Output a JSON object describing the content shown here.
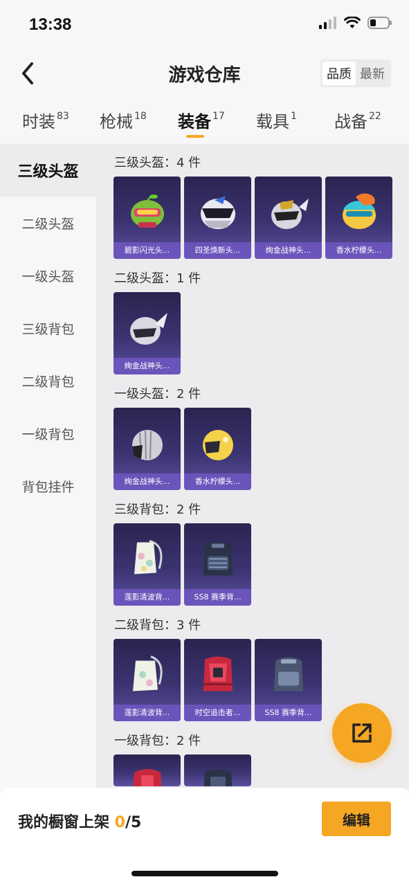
{
  "status": {
    "time": "13:38"
  },
  "nav": {
    "title": "游戏仓库",
    "sort": [
      "品质",
      "最新"
    ]
  },
  "tabs": [
    {
      "label": "时装",
      "count": "83"
    },
    {
      "label": "枪械",
      "count": "18"
    },
    {
      "label": "装备",
      "count": "17"
    },
    {
      "label": "载具",
      "count": "1"
    },
    {
      "label": "战备",
      "count": "22"
    }
  ],
  "sidebar": [
    "三级头盔",
    "二级头盔",
    "一级头盔",
    "三级背包",
    "二级背包",
    "一级背包",
    "背包挂件"
  ],
  "sections": [
    {
      "title": "三级头盔：4 件",
      "items": [
        "碧影闪光头...",
        "四圣焕新头...",
        "绚金战神头...",
        "香水柠檬头..."
      ]
    },
    {
      "title": "二级头盔：1 件",
      "items": [
        "绚金战神头..."
      ]
    },
    {
      "title": "一级头盔：2 件",
      "items": [
        "绚金战神头...",
        "香水柠檬头..."
      ]
    },
    {
      "title": "三级背包：2 件",
      "items": [
        "莲影清波背...",
        "SS8 赛季背..."
      ]
    },
    {
      "title": "二级背包：3 件",
      "items": [
        "莲影清波背...",
        "时空追击者...",
        "SS8 赛季背..."
      ]
    },
    {
      "title": "一级背包：2 件",
      "items": [
        "",
        ""
      ]
    }
  ],
  "bottom": {
    "label": "我的橱窗上架 ",
    "count": "0",
    "total": "/5",
    "edit": "编辑"
  }
}
